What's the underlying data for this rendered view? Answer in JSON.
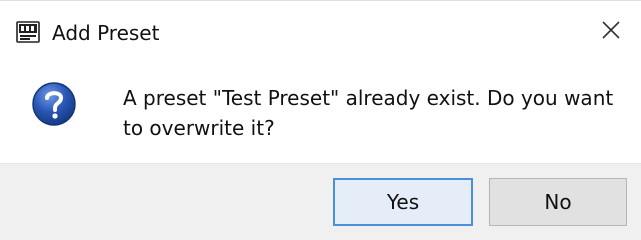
{
  "dialog": {
    "title": "Add Preset",
    "message": "A preset \"Test Preset\" already exist. Do you want to overwrite it?",
    "icons": {
      "app": "app-icon",
      "close": "close-icon",
      "question": "question-icon"
    },
    "buttons": {
      "yes_label": "Yes",
      "no_label": "No"
    },
    "colors": {
      "question_blue": "#2a57b5",
      "default_button_border": "#4a90d9",
      "footer_background": "#f0f0f0"
    }
  }
}
